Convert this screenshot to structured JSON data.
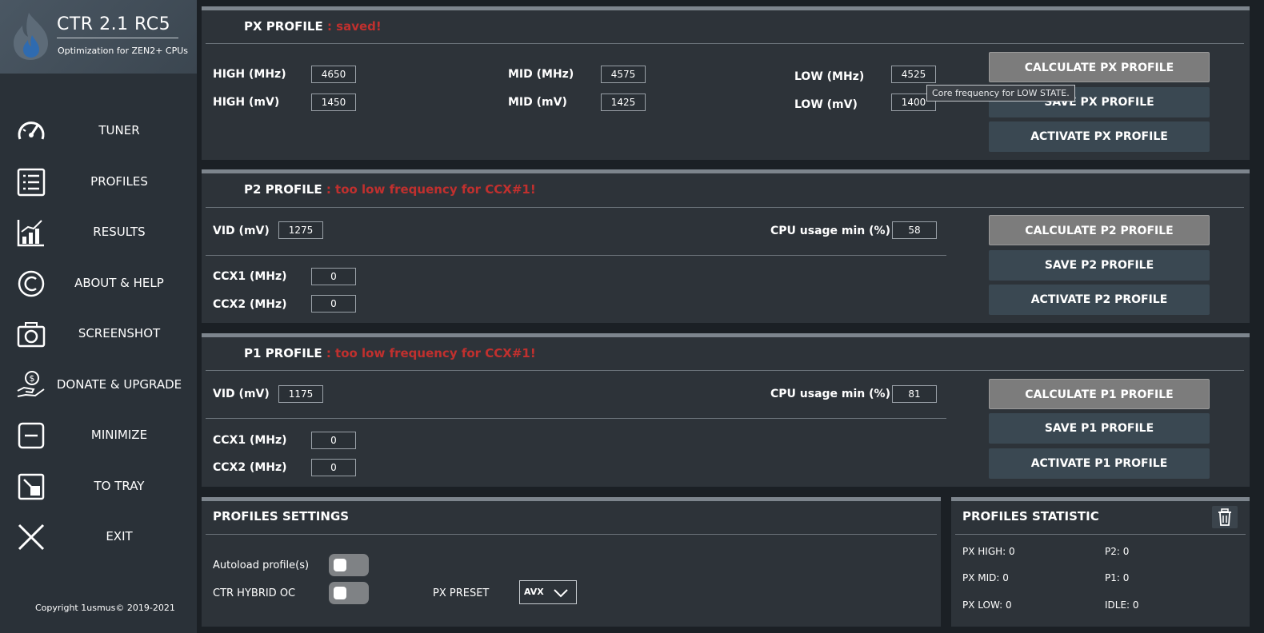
{
  "app": {
    "title": "CTR 2.1 RC5",
    "subtitle": "Optimization for ZEN2+ CPUs",
    "copyright": "Copyright 1usmus© 2019-2021"
  },
  "nav": [
    {
      "label": "TUNER",
      "icon": "gauge-icon"
    },
    {
      "label": "PROFILES",
      "icon": "list-icon"
    },
    {
      "label": "RESULTS",
      "icon": "chart-icon"
    },
    {
      "label": "ABOUT & HELP",
      "icon": "copyright-icon"
    },
    {
      "label": "SCREENSHOT",
      "icon": "camera-icon"
    },
    {
      "label": "DONATE & UPGRADE",
      "icon": "donate-icon"
    },
    {
      "label": "MINIMIZE",
      "icon": "minimize-icon"
    },
    {
      "label": "TO TRAY",
      "icon": "tray-icon"
    },
    {
      "label": "EXIT",
      "icon": "close-icon"
    }
  ],
  "px": {
    "title": "PX PROFILE",
    "status": " : saved!",
    "high_mhz_label": "HIGH (MHz)",
    "high_mhz": "4650",
    "high_mv_label": "HIGH  (mV)",
    "high_mv": "1450",
    "mid_mhz_label": "MID (MHz)",
    "mid_mhz": "4575",
    "mid_mv_label": "MID (mV)",
    "mid_mv": "1425",
    "low_mhz_label": "LOW (MHz)",
    "low_mhz": "4525",
    "low_mv_label": "LOW (mV)",
    "low_mv": "1400",
    "calc": "CALCULATE PX PROFILE",
    "save": "SAVE PX PROFILE",
    "activate": "ACTIVATE PX PROFILE",
    "tooltip": "Core frequency for LOW STATE."
  },
  "p2": {
    "title": "P2 PROFILE",
    "status": " : too low frequency for CCX#1!",
    "vid_label": "VID (mV)",
    "vid": "1275",
    "cpu_label": "CPU usage min (%)",
    "cpu": "58",
    "ccx1_label": "CCX1 (MHz)",
    "ccx1": "0",
    "ccx2_label": "CCX2 (MHz)",
    "ccx2": "0",
    "calc": "CALCULATE P2 PROFILE",
    "save": "SAVE P2 PROFILE",
    "activate": "ACTIVATE P2 PROFILE"
  },
  "p1": {
    "title": "P1 PROFILE",
    "status": " : too low frequency for CCX#1!",
    "vid_label": "VID (mV)",
    "vid": "1175",
    "cpu_label": "CPU usage min (%)",
    "cpu": "81",
    "ccx1_label": "CCX1 (MHz)",
    "ccx1": "0",
    "ccx2_label": "CCX2 (MHz)",
    "ccx2": "0",
    "calc": "CALCULATE P1 PROFILE",
    "save": "SAVE P1 PROFILE",
    "activate": "ACTIVATE P1 PROFILE"
  },
  "settings": {
    "title": "PROFILES SETTINGS",
    "autoload_label": "Autoload profile(s)",
    "hybrid_label": "CTR HYBRID OC",
    "preset_label": "PX PRESET",
    "preset_value": "AVX"
  },
  "stats": {
    "title": "PROFILES STATISTIC",
    "px_high": "PX HIGH: 0",
    "px_mid": "PX MID: 0",
    "px_low": "PX LOW: 0",
    "p2": "P2: 0",
    "p1": "P1: 0",
    "idle": "IDLE: 0"
  }
}
